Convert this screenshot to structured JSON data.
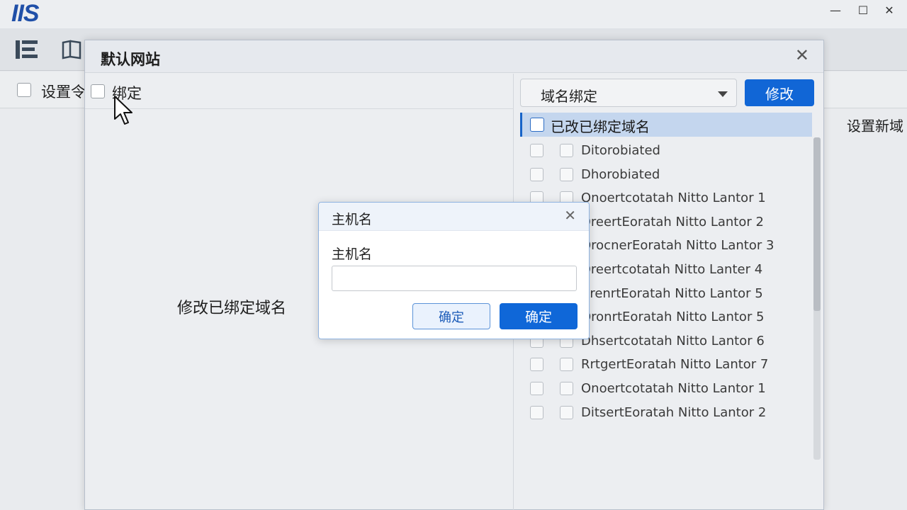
{
  "app": {
    "logo": "IIS",
    "window_controls": {
      "minimize": "—",
      "maximize": "☐",
      "close": "✕"
    }
  },
  "background": {
    "setting_label": "设置令",
    "right_label": "设置新域"
  },
  "site_dialog": {
    "title": "默认网站",
    "close": "✕",
    "bind_label": "绑定",
    "center_label": "修改已绑定域名",
    "select_value": "域名绑定",
    "modify_button": "修改",
    "list_header": "已改已绑定域名",
    "rows": [
      "Ditorobiated",
      "Dhorobiated",
      "Onoertcotatah Nitto Lantor 1",
      "DreertEoratah Nitto Lantor 2",
      "OrocnerEoratah Nitto Lantor 3",
      "Dreertcotatah Nitto Lanter 4",
      "ArenrtEoratah Nitto Lantor 5",
      "OronrtEoratah Nitto Lantor 5",
      "Dhsertcotatah Nitto Lantor 6",
      "RrtgertEoratah Nitto Lantor 7",
      "Onoertcotatah Nitto Lantor 1",
      "DitsertEoratah Nitto Lantor 2"
    ]
  },
  "host_dialog": {
    "title": "主机名",
    "close": "✕",
    "field_label": "主机名",
    "input_value": "",
    "input_placeholder": "",
    "cancel_button": "确定",
    "ok_button": "确定"
  },
  "icons": {
    "toolbar_1": "list-icon",
    "toolbar_2": "book-icon",
    "cursor": "cursor-icon"
  },
  "colors": {
    "accent": "#1166d6",
    "list_header_bg": "#c4d6ee",
    "logo": "#1f4fa8"
  }
}
